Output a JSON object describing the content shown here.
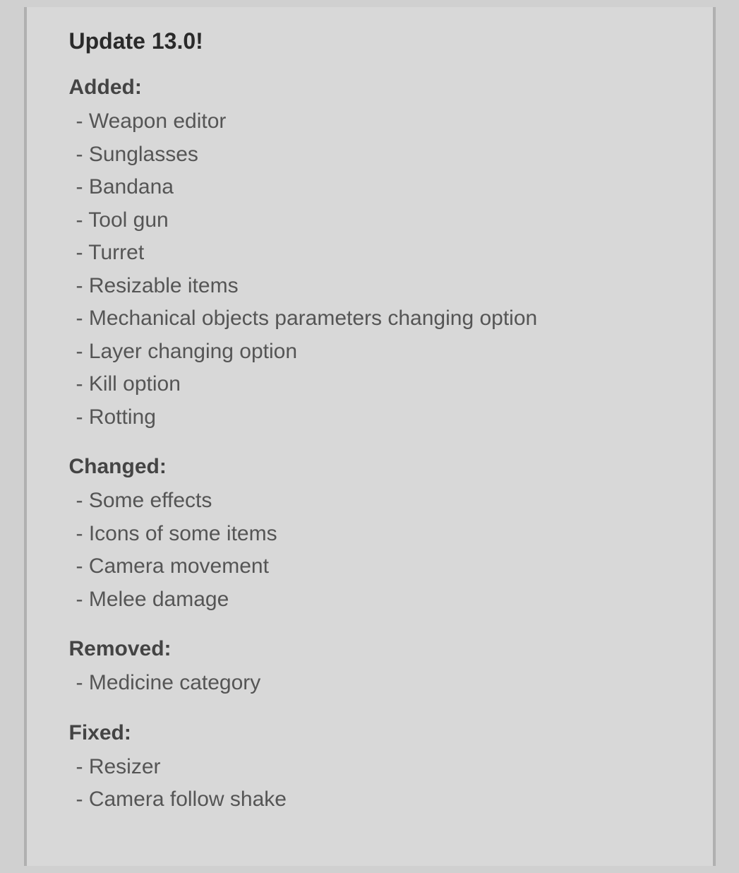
{
  "page": {
    "update_title": "Update 13.0!",
    "sections": [
      {
        "id": "added",
        "header": "Added:",
        "items": [
          "- Weapon editor",
          "- Sunglasses",
          "- Bandana",
          "- Tool gun",
          "- Turret",
          "- Resizable items",
          "- Mechanical objects parameters changing option",
          "- Layer changing option",
          "- Kill option",
          "- Rotting"
        ]
      },
      {
        "id": "changed",
        "header": "Changed:",
        "items": [
          "- Some effects",
          "- Icons of some items",
          "- Camera movement",
          "- Melee damage"
        ]
      },
      {
        "id": "removed",
        "header": "Removed:",
        "items": [
          "- Medicine category"
        ]
      },
      {
        "id": "fixed",
        "header": "Fixed:",
        "items": [
          "- Resizer",
          "- Camera follow shake"
        ]
      }
    ]
  }
}
